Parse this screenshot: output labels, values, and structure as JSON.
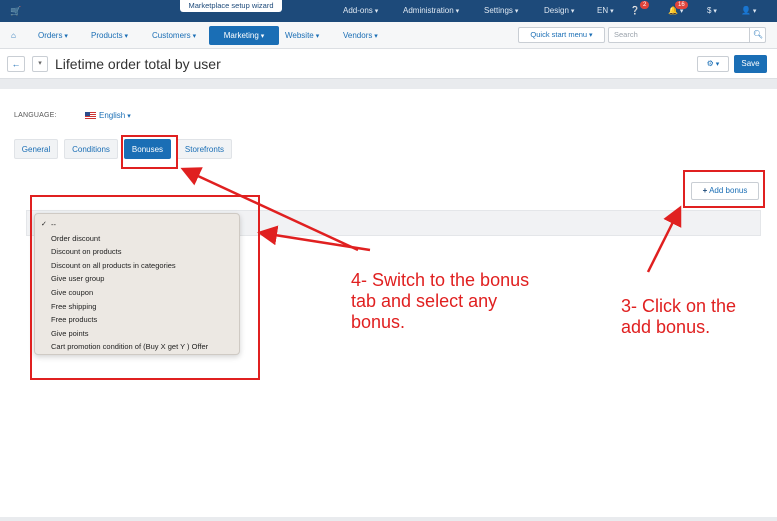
{
  "topbar": {
    "cart_icon": "cart-icon",
    "wizard_label": "Marketplace setup wizard",
    "menus": [
      "Add-ons",
      "Administration",
      "Settings",
      "Design",
      "EN",
      "$"
    ],
    "help_badge": "2",
    "notifications_badge": "16"
  },
  "nav": {
    "home_icon": "home-icon",
    "items": [
      "Orders",
      "Products",
      "Customers",
      "Marketing",
      "Website",
      "Vendors"
    ],
    "active_item": "Marketing",
    "quick_start": "Quick start menu",
    "search_placeholder": "Search"
  },
  "titlebar": {
    "title": "Lifetime order total by user",
    "save_label": "Save"
  },
  "language": {
    "label": "LANGUAGE:",
    "value": "English"
  },
  "tabs": [
    "General",
    "Conditions",
    "Bonuses",
    "Storefronts"
  ],
  "active_tab": "Bonuses",
  "add_bonus": {
    "plus": "+",
    "label": "Add bonus"
  },
  "bonus_select": {
    "selected": "--",
    "options": [
      "--",
      "Order discount",
      "Discount on products",
      "Discount on all products in categories",
      "Give user group",
      "Give coupon",
      "Free shipping",
      "Free products",
      "Give points",
      "Cart promotion condition of (Buy X get Y ) Offer"
    ]
  },
  "annotations": {
    "step4": [
      "4- Switch to the bonus",
      "tab and select any",
      "bonus."
    ],
    "step3": [
      "3- Click on the",
      "add bonus."
    ],
    "color": "#e02020"
  },
  "colors": {
    "topbar": "#1d4a7a",
    "accent": "#1a6eb5"
  }
}
